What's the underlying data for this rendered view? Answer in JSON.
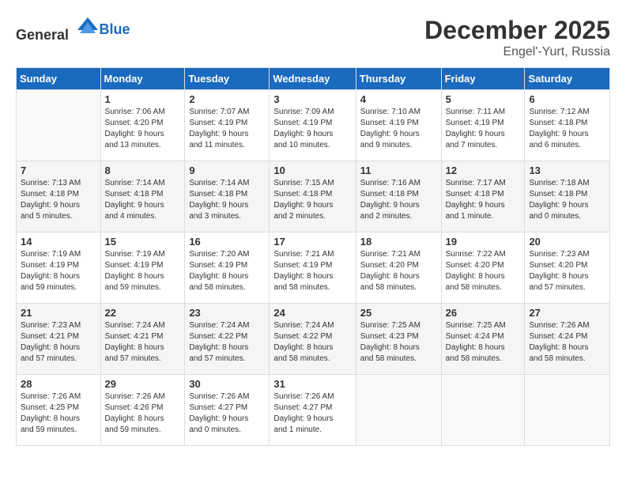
{
  "header": {
    "logo_general": "General",
    "logo_blue": "Blue",
    "month_title": "December 2025",
    "location": "Engel'-Yurt, Russia"
  },
  "days_of_week": [
    "Sunday",
    "Monday",
    "Tuesday",
    "Wednesday",
    "Thursday",
    "Friday",
    "Saturday"
  ],
  "weeks": [
    [
      {
        "day": "",
        "info": ""
      },
      {
        "day": "1",
        "info": "Sunrise: 7:06 AM\nSunset: 4:20 PM\nDaylight: 9 hours\nand 13 minutes."
      },
      {
        "day": "2",
        "info": "Sunrise: 7:07 AM\nSunset: 4:19 PM\nDaylight: 9 hours\nand 11 minutes."
      },
      {
        "day": "3",
        "info": "Sunrise: 7:09 AM\nSunset: 4:19 PM\nDaylight: 9 hours\nand 10 minutes."
      },
      {
        "day": "4",
        "info": "Sunrise: 7:10 AM\nSunset: 4:19 PM\nDaylight: 9 hours\nand 9 minutes."
      },
      {
        "day": "5",
        "info": "Sunrise: 7:11 AM\nSunset: 4:19 PM\nDaylight: 9 hours\nand 7 minutes."
      },
      {
        "day": "6",
        "info": "Sunrise: 7:12 AM\nSunset: 4:18 PM\nDaylight: 9 hours\nand 6 minutes."
      }
    ],
    [
      {
        "day": "7",
        "info": "Sunrise: 7:13 AM\nSunset: 4:18 PM\nDaylight: 9 hours\nand 5 minutes."
      },
      {
        "day": "8",
        "info": "Sunrise: 7:14 AM\nSunset: 4:18 PM\nDaylight: 9 hours\nand 4 minutes."
      },
      {
        "day": "9",
        "info": "Sunrise: 7:14 AM\nSunset: 4:18 PM\nDaylight: 9 hours\nand 3 minutes."
      },
      {
        "day": "10",
        "info": "Sunrise: 7:15 AM\nSunset: 4:18 PM\nDaylight: 9 hours\nand 2 minutes."
      },
      {
        "day": "11",
        "info": "Sunrise: 7:16 AM\nSunset: 4:18 PM\nDaylight: 9 hours\nand 2 minutes."
      },
      {
        "day": "12",
        "info": "Sunrise: 7:17 AM\nSunset: 4:18 PM\nDaylight: 9 hours\nand 1 minute."
      },
      {
        "day": "13",
        "info": "Sunrise: 7:18 AM\nSunset: 4:18 PM\nDaylight: 9 hours\nand 0 minutes."
      }
    ],
    [
      {
        "day": "14",
        "info": "Sunrise: 7:19 AM\nSunset: 4:19 PM\nDaylight: 8 hours\nand 59 minutes."
      },
      {
        "day": "15",
        "info": "Sunrise: 7:19 AM\nSunset: 4:19 PM\nDaylight: 8 hours\nand 59 minutes."
      },
      {
        "day": "16",
        "info": "Sunrise: 7:20 AM\nSunset: 4:19 PM\nDaylight: 8 hours\nand 58 minutes."
      },
      {
        "day": "17",
        "info": "Sunrise: 7:21 AM\nSunset: 4:19 PM\nDaylight: 8 hours\nand 58 minutes."
      },
      {
        "day": "18",
        "info": "Sunrise: 7:21 AM\nSunset: 4:20 PM\nDaylight: 8 hours\nand 58 minutes."
      },
      {
        "day": "19",
        "info": "Sunrise: 7:22 AM\nSunset: 4:20 PM\nDaylight: 8 hours\nand 58 minutes."
      },
      {
        "day": "20",
        "info": "Sunrise: 7:23 AM\nSunset: 4:20 PM\nDaylight: 8 hours\nand 57 minutes."
      }
    ],
    [
      {
        "day": "21",
        "info": "Sunrise: 7:23 AM\nSunset: 4:21 PM\nDaylight: 8 hours\nand 57 minutes."
      },
      {
        "day": "22",
        "info": "Sunrise: 7:24 AM\nSunset: 4:21 PM\nDaylight: 8 hours\nand 57 minutes."
      },
      {
        "day": "23",
        "info": "Sunrise: 7:24 AM\nSunset: 4:22 PM\nDaylight: 8 hours\nand 57 minutes."
      },
      {
        "day": "24",
        "info": "Sunrise: 7:24 AM\nSunset: 4:22 PM\nDaylight: 8 hours\nand 58 minutes."
      },
      {
        "day": "25",
        "info": "Sunrise: 7:25 AM\nSunset: 4:23 PM\nDaylight: 8 hours\nand 58 minutes."
      },
      {
        "day": "26",
        "info": "Sunrise: 7:25 AM\nSunset: 4:24 PM\nDaylight: 8 hours\nand 58 minutes."
      },
      {
        "day": "27",
        "info": "Sunrise: 7:26 AM\nSunset: 4:24 PM\nDaylight: 8 hours\nand 58 minutes."
      }
    ],
    [
      {
        "day": "28",
        "info": "Sunrise: 7:26 AM\nSunset: 4:25 PM\nDaylight: 8 hours\nand 59 minutes."
      },
      {
        "day": "29",
        "info": "Sunrise: 7:26 AM\nSunset: 4:26 PM\nDaylight: 8 hours\nand 59 minutes."
      },
      {
        "day": "30",
        "info": "Sunrise: 7:26 AM\nSunset: 4:27 PM\nDaylight: 9 hours\nand 0 minutes."
      },
      {
        "day": "31",
        "info": "Sunrise: 7:26 AM\nSunset: 4:27 PM\nDaylight: 9 hours\nand 1 minute."
      },
      {
        "day": "",
        "info": ""
      },
      {
        "day": "",
        "info": ""
      },
      {
        "day": "",
        "info": ""
      }
    ]
  ]
}
